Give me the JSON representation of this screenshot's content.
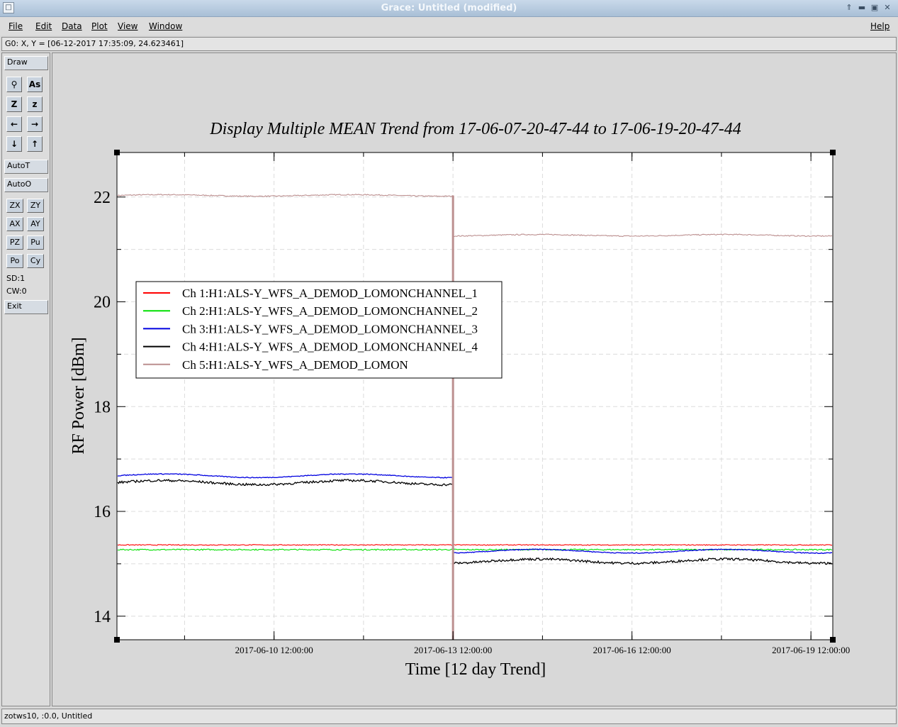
{
  "window": {
    "title": "Grace: Untitled (modified)",
    "controls": [
      "chevron-up-icon",
      "minimize-icon",
      "maximize-icon",
      "close-icon"
    ]
  },
  "menubar": {
    "items": [
      "File",
      "Edit",
      "Data",
      "Plot",
      "View",
      "Window"
    ],
    "help": "Help"
  },
  "locator": "G0: X, Y = [06-12-2017 17:35:09, 24.623461]",
  "toolbar": {
    "draw": "Draw",
    "icon_buttons": [
      {
        "name": "zoom-icon",
        "glyph": "⚲"
      },
      {
        "name": "text-icon",
        "glyph": "As"
      },
      {
        "name": "zoom-xy-icon",
        "glyph": "Z"
      },
      {
        "name": "zoom-small-icon",
        "glyph": "z"
      },
      {
        "name": "arrow-left-icon",
        "glyph": "←"
      },
      {
        "name": "arrow-right-icon",
        "glyph": "→"
      },
      {
        "name": "arrow-down-icon",
        "glyph": "↓"
      },
      {
        "name": "arrow-up-icon",
        "glyph": "↑"
      }
    ],
    "autot": "AutoT",
    "autoo": "AutoO",
    "small_buttons": [
      "ZX",
      "ZY",
      "AX",
      "AY",
      "PZ",
      "Pu",
      "Po",
      "Cy"
    ],
    "sd": "SD:1",
    "cw": "CW:0",
    "exit": "Exit"
  },
  "status": "zotws10, :0.0, Untitled",
  "chart_data": {
    "type": "line",
    "title": "Display Multiple MEAN Trend from 17-06-07-20-47-44 to 17-06-19-20-47-44",
    "xlabel": "Time [12 day Trend]",
    "ylabel": "RF Power [dBm]",
    "xlim": [
      "2017-06-07 20:47:44",
      "2017-06-19 20:47:44"
    ],
    "ylim": [
      13.55,
      22.85
    ],
    "yticks": [
      14,
      16,
      18,
      20,
      22
    ],
    "xticks": [
      "2017-06-10 12:00:00",
      "2017-06-13 12:00:00",
      "2017-06-16 12:00:00",
      "2017-06-19 12:00:00"
    ],
    "grid": true,
    "legend_position": "upper-left",
    "step_time": "2017-06-13 12:00:00",
    "series": [
      {
        "name": "Ch 1:H1:ALS-Y_WFS_A_DEMOD_LOMONCHANNEL_1",
        "color": "#ff0000",
        "before": 15.36,
        "after": 15.36,
        "noise": 0.008,
        "wave": 0
      },
      {
        "name": "Ch 2:H1:ALS-Y_WFS_A_DEMOD_LOMONCHANNEL_2",
        "color": "#00e000",
        "before": 15.27,
        "after": 15.27,
        "noise": 0.012,
        "wave": 0
      },
      {
        "name": "Ch 3:H1:ALS-Y_WFS_A_DEMOD_LOMONCHANNEL_3",
        "color": "#0000e0",
        "before": 16.68,
        "after": 15.24,
        "noise": 0.008,
        "wave": 0.035
      },
      {
        "name": "Ch 4:H1:ALS-Y_WFS_A_DEMOD_LOMONCHANNEL_4",
        "color": "#000000",
        "before": 16.55,
        "after": 15.05,
        "noise": 0.022,
        "wave": 0.04
      },
      {
        "name": "Ch 5:H1:ALS-Y_WFS_A_DEMOD_LOMON",
        "color": "#bc8f8f",
        "before": 22.03,
        "after": 21.27,
        "noise": 0.01,
        "wave": 0.015
      }
    ]
  }
}
